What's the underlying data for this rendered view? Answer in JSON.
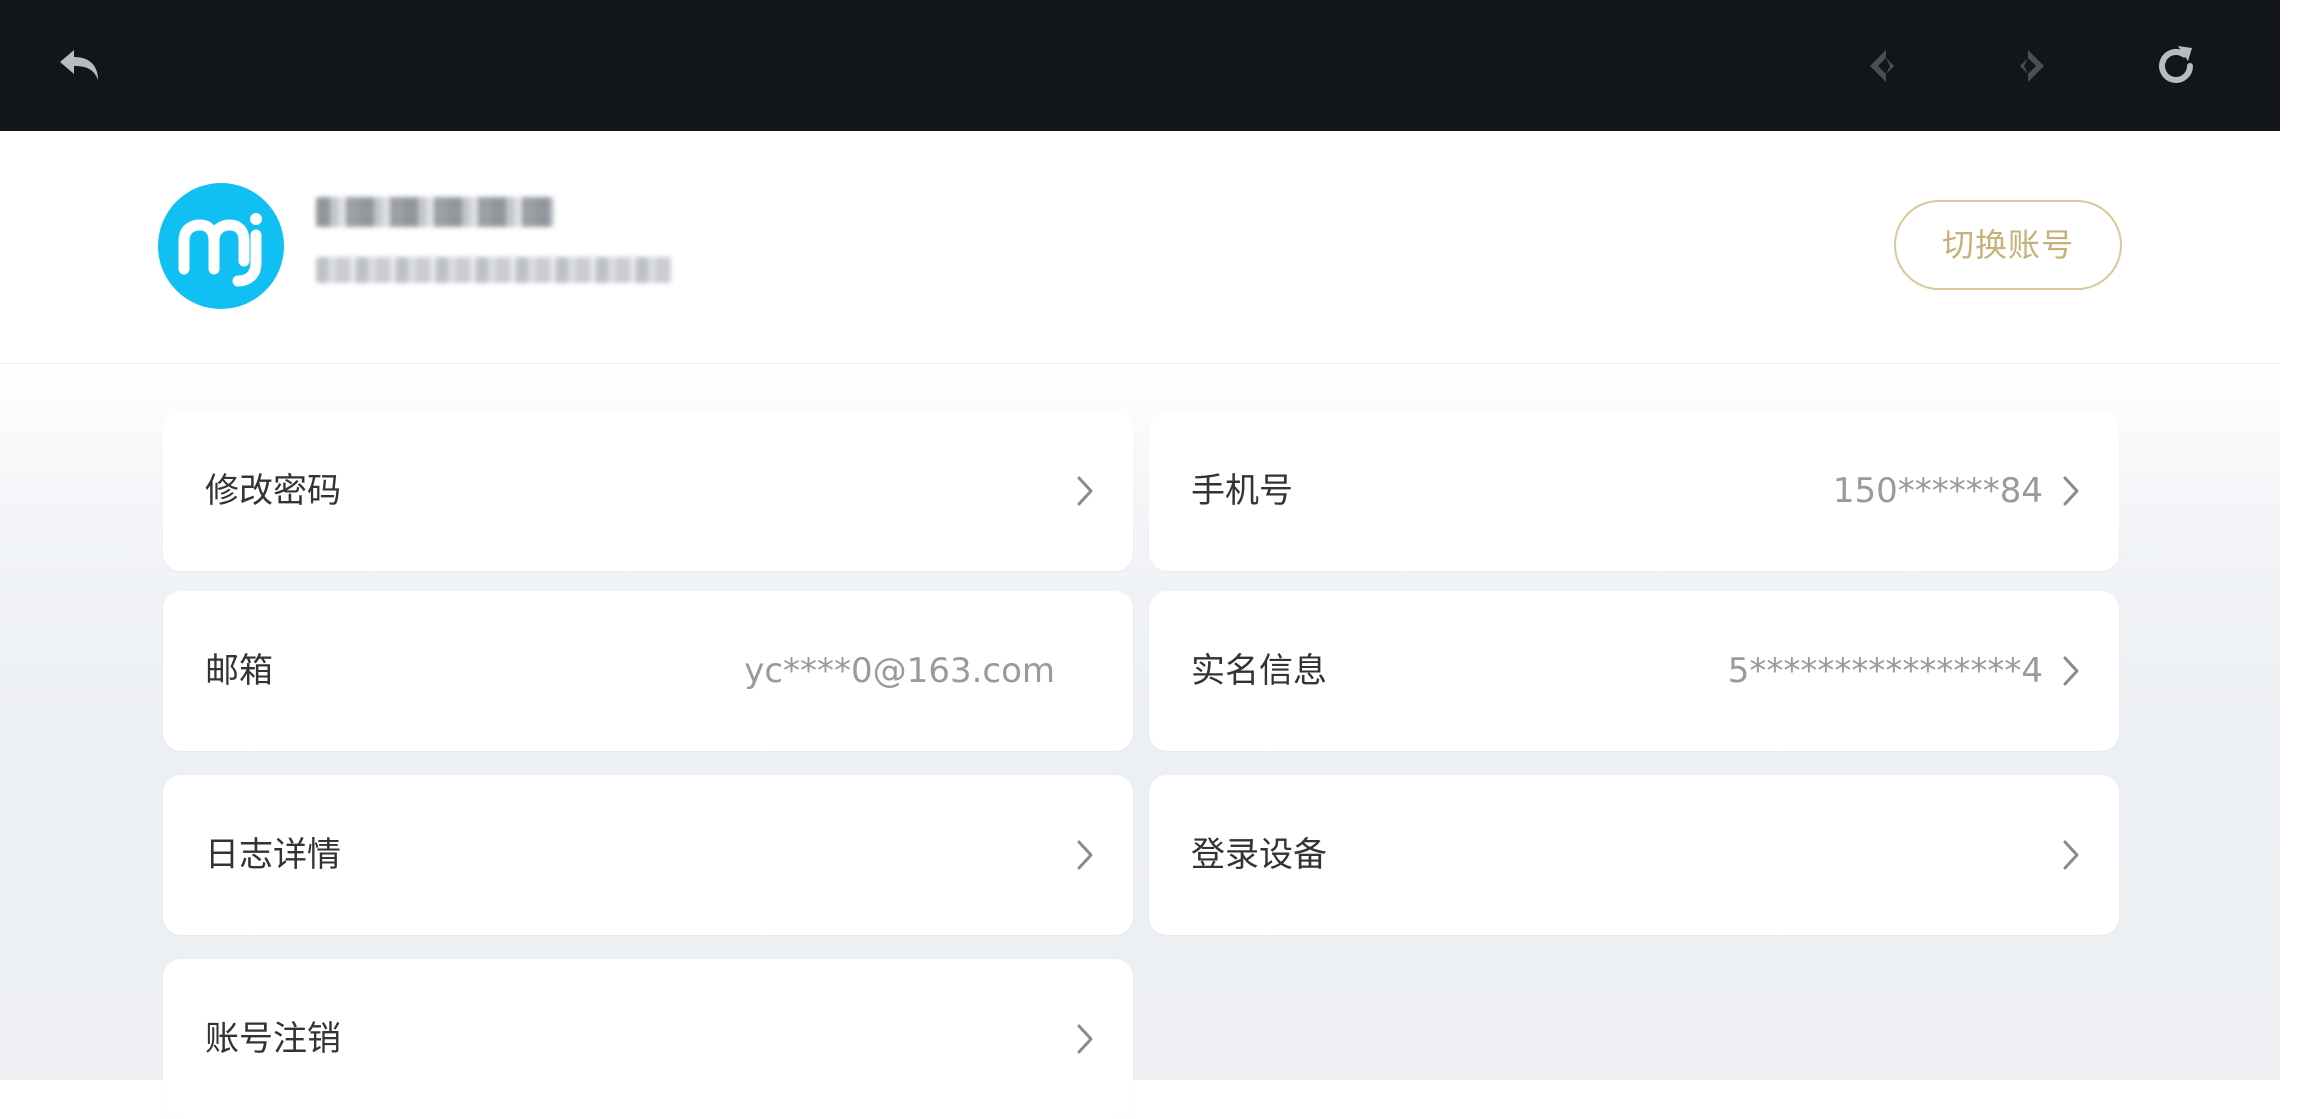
{
  "topbar": {
    "back_icon": "back-arrow-icon",
    "prev_icon": "previous-arrow-icon",
    "next_icon": "next-arrow-icon",
    "refresh_icon": "refresh-icon",
    "background": "#12161b"
  },
  "header": {
    "avatar_icon": "mi-logo-icon",
    "avatar_color": "#10c0f3",
    "switch_account_label": "切换账号",
    "switch_account_color": "#c8b07a"
  },
  "settings": {
    "change_password": {
      "label": "修改密码"
    },
    "phone": {
      "label": "手机号",
      "value": "150******84"
    },
    "email": {
      "label": "邮箱",
      "value": "yc****0@163.com"
    },
    "real_name": {
      "label": "实名信息",
      "value": "5****************4"
    },
    "log_details": {
      "label": "日志详情"
    },
    "login_devices": {
      "label": "登录设备"
    },
    "delete_account": {
      "label": "账号注销"
    }
  },
  "colors": {
    "value_text": "#9a9a9a",
    "label_text": "#333333",
    "chevron": "#8a8a8a"
  }
}
